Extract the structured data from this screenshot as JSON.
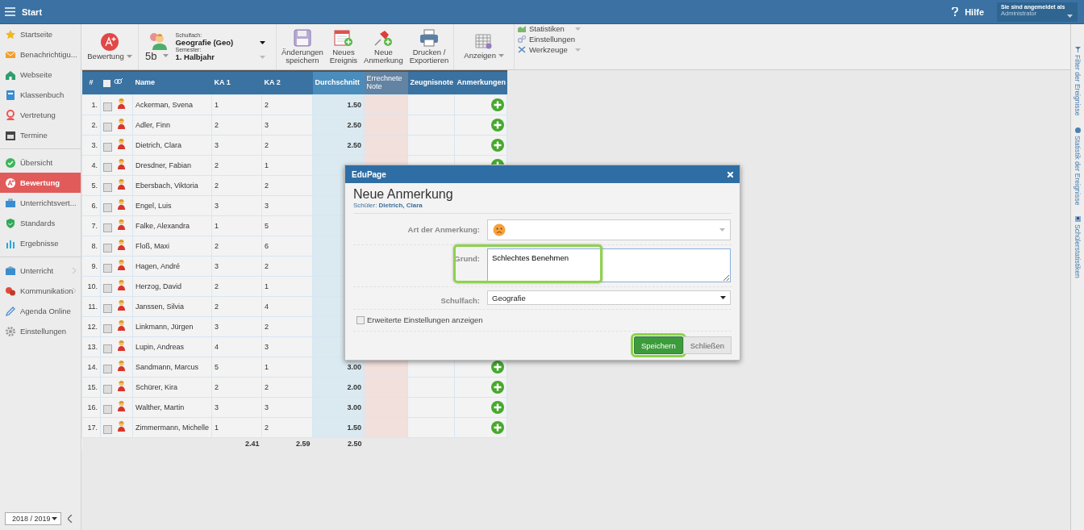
{
  "topbar": {
    "title": "Start",
    "help": "Hilfe",
    "login_label": "Sie sind angemeldet als",
    "user": "Administrator"
  },
  "sidebar": {
    "sections": [
      [
        {
          "label": "Startseite",
          "selected": false,
          "submenu": false
        },
        {
          "label": "Benachrichtigu...",
          "selected": false,
          "submenu": false
        },
        {
          "label": "Webseite",
          "selected": false,
          "submenu": false
        },
        {
          "label": "Klassenbuch",
          "selected": false,
          "submenu": false
        },
        {
          "label": "Vertretung",
          "selected": false,
          "submenu": false
        },
        {
          "label": "Termine",
          "selected": false,
          "submenu": false
        }
      ],
      [
        {
          "label": "Übersicht",
          "selected": false,
          "submenu": false
        },
        {
          "label": "Bewertung",
          "selected": true,
          "submenu": false
        },
        {
          "label": "Unterrichtsvert...",
          "selected": false,
          "submenu": false
        },
        {
          "label": "Standards",
          "selected": false,
          "submenu": false
        },
        {
          "label": "Ergebnisse",
          "selected": false,
          "submenu": false
        }
      ],
      [
        {
          "label": "Unterricht",
          "selected": false,
          "submenu": true
        },
        {
          "label": "Kommunikation",
          "selected": false,
          "submenu": true
        },
        {
          "label": "Agenda Online",
          "selected": false,
          "submenu": false
        },
        {
          "label": "Einstellungen",
          "selected": false,
          "submenu": false
        }
      ]
    ],
    "year": "2018 / 2019"
  },
  "toolbar": {
    "grading": "Bewertung",
    "class": "5b",
    "subject_label": "Schulfach:",
    "subject": "Geografie (Geo)",
    "semester_label": "Semester:",
    "semester": "1. Halbjahr",
    "buttons": [
      {
        "label": "Änderungen\nspeichern"
      },
      {
        "label": "Neues\nEreignis"
      },
      {
        "label": "Neue\nAnmerkung"
      },
      {
        "label": "Drucken /\nExportieren"
      }
    ],
    "view": "Anzeigen",
    "menu": [
      {
        "label": "Statistiken",
        "dropdown": true
      },
      {
        "label": "Einstellungen",
        "dropdown": false
      },
      {
        "label": "Werkzeuge",
        "dropdown": true
      }
    ]
  },
  "table": {
    "columns": [
      "#",
      "Name",
      "KA 1",
      "KA 2",
      "Durchschnitt",
      "Errechnete Note",
      "Zeugnisnote",
      "Anmerkungen"
    ],
    "select_all_checked": false,
    "rows": [
      {
        "no": "1.",
        "checked": false,
        "name": "Ackerman, Svena",
        "ka1": "1",
        "ka2": "2",
        "average": "1.50",
        "note_button": true
      },
      {
        "no": "2.",
        "checked": false,
        "name": "Adler, Finn",
        "ka1": "2",
        "ka2": "3",
        "average": "2.50",
        "note_button": true
      },
      {
        "no": "3.",
        "checked": false,
        "name": "Dietrich, Clara",
        "ka1": "3",
        "ka2": "2",
        "average": "2.50",
        "note_button": true
      },
      {
        "no": "4.",
        "checked": false,
        "name": "Dresdner, Fabian",
        "ka1": "2",
        "ka2": "1",
        "note_button": true
      },
      {
        "no": "5.",
        "checked": false,
        "name": "Ebersbach, Viktoria",
        "ka1": "2",
        "ka2": "2",
        "note_button": false
      },
      {
        "no": "6.",
        "checked": false,
        "name": "Engel, Luis",
        "ka1": "3",
        "ka2": "3",
        "note_button": false
      },
      {
        "no": "7.",
        "checked": false,
        "name": "Falke, Alexandra",
        "ka1": "1",
        "ka2": "5",
        "note_button": false
      },
      {
        "no": "8.",
        "checked": false,
        "name": "Floß, Maxi",
        "ka1": "2",
        "ka2": "6",
        "note_button": false
      },
      {
        "no": "9.",
        "checked": false,
        "name": "Hagen, André",
        "ka1": "3",
        "ka2": "2",
        "note_button": false
      },
      {
        "no": "10.",
        "checked": false,
        "name": "Herzog, David",
        "ka1": "2",
        "ka2": "1",
        "note_button": false
      },
      {
        "no": "11.",
        "checked": false,
        "name": "Janssen, Silvia",
        "ka1": "2",
        "ka2": "4",
        "note_button": false
      },
      {
        "no": "12.",
        "checked": false,
        "name": "Linkmann, Jürgen",
        "ka1": "3",
        "ka2": "2",
        "note_button": false
      },
      {
        "no": "13.",
        "checked": false,
        "name": "Lupin, Andreas",
        "ka1": "4",
        "ka2": "3",
        "note_button": false
      },
      {
        "no": "14.",
        "checked": false,
        "name": "Sandmann, Marcus",
        "ka1": "5",
        "ka2": "1",
        "average": "3.00",
        "note_button": true
      },
      {
        "no": "15.",
        "checked": false,
        "name": "Schürer, Kira",
        "ka1": "2",
        "ka2": "2",
        "average": "2.00",
        "note_button": true
      },
      {
        "no": "16.",
        "checked": false,
        "name": "Walther, Martin",
        "ka1": "3",
        "ka2": "3",
        "average": "3.00",
        "note_button": true
      },
      {
        "no": "17.",
        "checked": false,
        "name": "Zimmermann, Michelle",
        "ka1": "1",
        "ka2": "2",
        "average": "1.50",
        "note_button": true
      }
    ],
    "footer": {
      "ka1": "2.41",
      "ka2": "2.59",
      "average": "2.50"
    }
  },
  "dialog": {
    "title": "EduPage",
    "heading": "Neue Anmerkung",
    "student": "Schüler: **Dietrich, Clara**",
    "fields": [
      {
        "kind": "icon-select",
        "label": "Art der Anmerkung:",
        "highlighted": false
      },
      {
        "kind": "textarea",
        "label": "Grund:",
        "value": "Schlechtes Benehmen",
        "highlighted": true
      },
      {
        "kind": "select",
        "label": "Schulfach:",
        "value": "Geografie",
        "highlighted": false
      }
    ],
    "advanced": {
      "label": "Erweiterte Einstellungen anzeigen",
      "checked": false
    },
    "buttons": [
      {
        "label": "Speichern",
        "kind": "primary",
        "highlighted": true
      },
      {
        "label": "Schließen",
        "kind": "secondary",
        "highlighted": false
      }
    ]
  },
  "right_panel": [
    "Filter der Ereignisse",
    "Statistik der Ereignisse",
    "Schülerstatistiken"
  ]
}
